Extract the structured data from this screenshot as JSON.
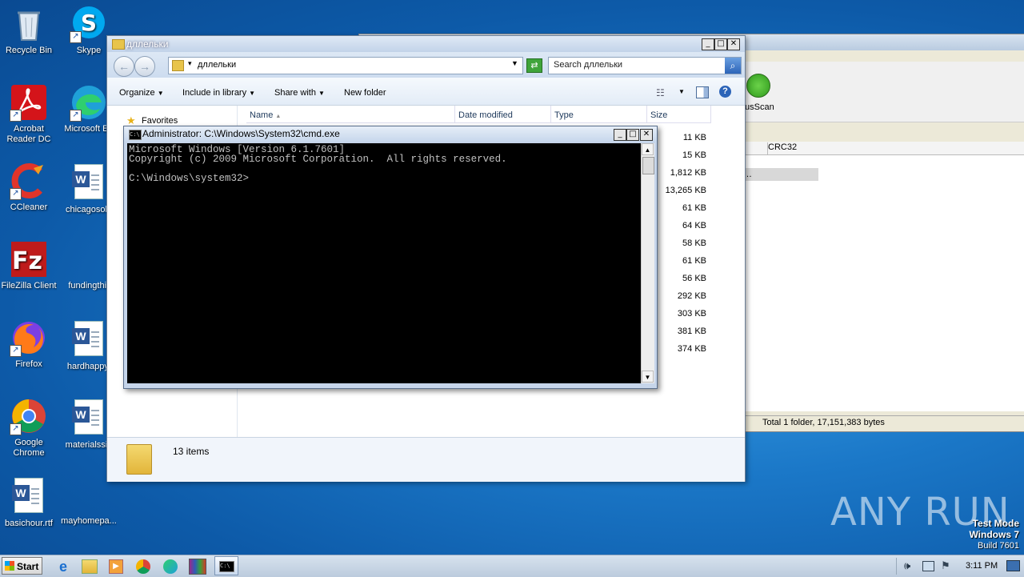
{
  "desktop": {
    "icons": [
      {
        "label": "Recycle Bin"
      },
      {
        "label": "Skype"
      },
      {
        "label": "Acrobat Reader DC"
      },
      {
        "label": "Microsoft Ed"
      },
      {
        "label": "CCleaner"
      },
      {
        "label": "chicagosolu"
      },
      {
        "label": "FileZilla Client"
      },
      {
        "label": "fundingthir"
      },
      {
        "label": "Firefox"
      },
      {
        "label": "hardhappy."
      },
      {
        "label": "Google Chrome"
      },
      {
        "label": "materialssin"
      },
      {
        "label": "basichour.rtf"
      },
      {
        "label": "mayhomepa..."
      }
    ]
  },
  "background_window": {
    "tool_label": "usScan",
    "column": "CRC32",
    "row_fragment": "…",
    "status": "Total 1 folder, 17,151,383 bytes"
  },
  "explorer": {
    "title": "дллельки",
    "address": "дллельки",
    "search_placeholder": "Search дллельки",
    "toolbar": {
      "organize": "Organize",
      "include": "Include in library",
      "share": "Share with",
      "newfolder": "New folder"
    },
    "nav": {
      "favorites": "Favorites"
    },
    "columns": {
      "name": "Name",
      "date": "Date modified",
      "type": "Type",
      "size": "Size"
    },
    "sizes": [
      "11 KB",
      "15 KB",
      "1,812 KB",
      "13,265 KB",
      "61 KB",
      "64 KB",
      "58 KB",
      "61 KB",
      "56 KB",
      "292 KB",
      "303 KB",
      "381 KB",
      "374 KB"
    ],
    "details": "13 items"
  },
  "cmd": {
    "title": "Administrator: C:\\Windows\\System32\\cmd.exe",
    "lines": [
      "Microsoft Windows [Version 6.1.7601]",
      "Copyright (c) 2009 Microsoft Corporation.  All rights reserved.",
      "",
      "C:\\Windows\\system32>"
    ]
  },
  "taskbar": {
    "start": "Start",
    "clock": "3:11 PM"
  },
  "watermark": "ANY RUN",
  "testmode": {
    "line1": "Test Mode",
    "line2": "Windows 7",
    "line3": "Build 7601"
  }
}
